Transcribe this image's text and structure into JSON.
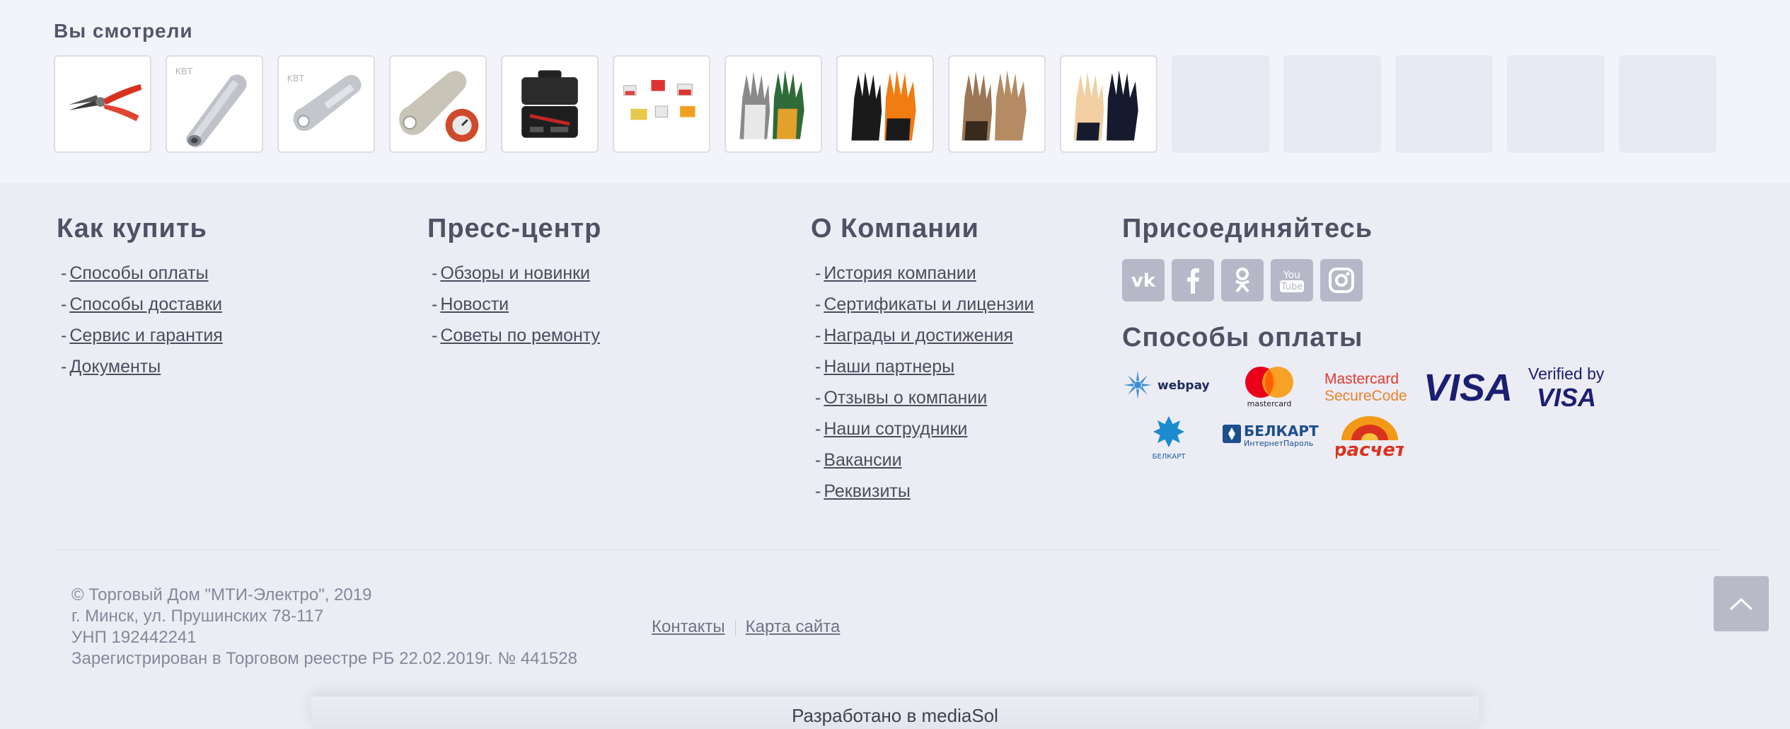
{
  "viewed": {
    "title": "Вы смотрели",
    "items": [
      {
        "icon": "pliers-icon"
      },
      {
        "icon": "sleeve-connector-icon",
        "brand": "KBT"
      },
      {
        "icon": "cable-lug-icon",
        "brand": "KBT"
      },
      {
        "icon": "copper-lug-icon"
      },
      {
        "icon": "tool-case-icon"
      },
      {
        "icon": "terminal-blocks-icon"
      },
      {
        "icon": "gloves-green-icon"
      },
      {
        "icon": "gloves-black-orange-icon"
      },
      {
        "icon": "gloves-brown-icon"
      },
      {
        "icon": "gloves-beige-black-icon"
      }
    ],
    "empty_slots": 5
  },
  "footer": {
    "how_to_buy": {
      "title": "Как купить",
      "links": [
        "Способы оплаты",
        "Способы доставки",
        "Сервис и гарантия",
        "Документы"
      ]
    },
    "press": {
      "title": "Пресс-центр",
      "links": [
        "Обзоры и новинки",
        "Новости",
        "Советы по ремонту"
      ]
    },
    "company": {
      "title": "О Компании",
      "links": [
        "История компании",
        "Сертификаты и лицензии",
        "Награды и достижения",
        "Наши партнеры",
        "Отзывы о компании",
        "Наши сотрудники",
        "Вакансии",
        "Реквизиты"
      ]
    },
    "join": {
      "title": "Присоединяйтесь",
      "socials": [
        "vk-icon",
        "facebook-icon",
        "odnoklassniki-icon",
        "youtube-icon",
        "instagram-icon"
      ],
      "youtube_text": [
        "You",
        "Tube"
      ]
    },
    "payment": {
      "title": "Способы оплаты",
      "logos": {
        "webpay": "webpay",
        "mastercard": "mastercard",
        "mc_secure": [
          "Mastercard",
          "SecureCode"
        ],
        "visa": "VISA",
        "verified": [
          "Verified by",
          "VISA"
        ],
        "belkart": "БЕЛКАРТ",
        "belkart_ip": [
          "БЕЛКАРТ",
          "ИнтернетПароль"
        ],
        "raschet": "расчет"
      }
    },
    "copyright": [
      "© Торговый Дом \"МТИ-Электро\", 2019",
      "г. Минск, ул. Прушинских 78-117",
      "УНП 192442241",
      "Зарегистрирован в Торговом реестре РБ 22.02.2019г. № 441528"
    ],
    "bottom_links": [
      "Контакты",
      "Карта сайта"
    ],
    "developed_by": "Разработано в mediaSol"
  },
  "colors": {
    "background": "#ececf4",
    "viewed_background": "#f3f3fa",
    "social_icon": "#b6b8c8",
    "visa_blue": "#1a1f71",
    "mastercard_red": "#eb001b",
    "mastercard_orange": "#f79e1b"
  }
}
